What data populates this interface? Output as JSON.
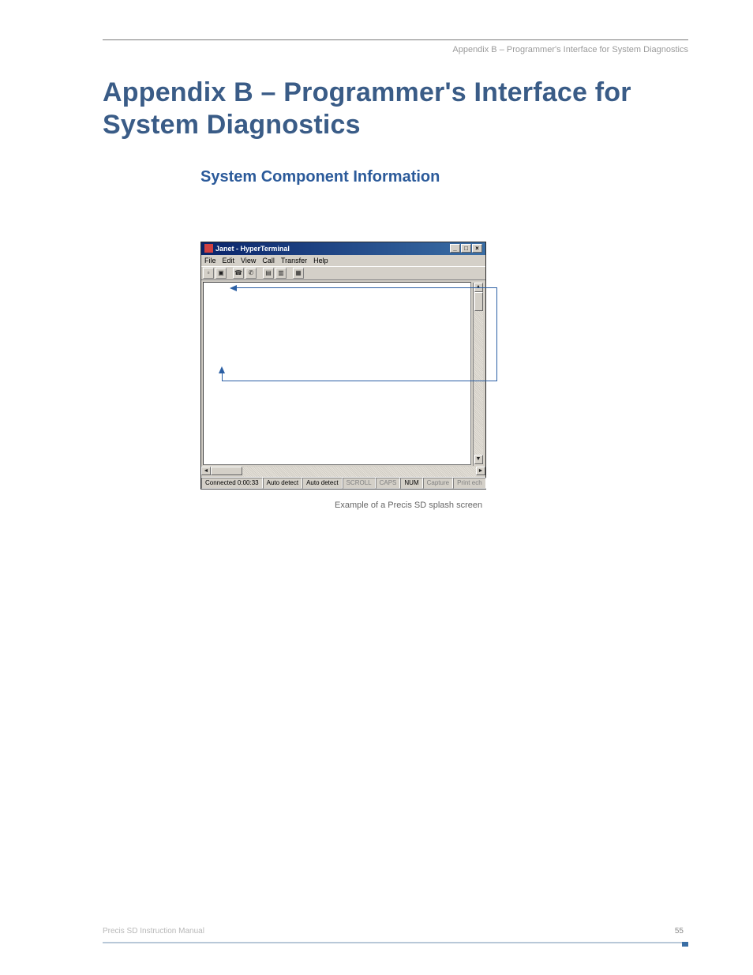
{
  "breadcrumb": "Appendix B – Programmer's Interface for System Diagnostics",
  "page_title": "Appendix B – Programmer's Interface for System Diagnostics",
  "section_heading": "System Component Information",
  "figure_caption": "Example of a Precis SD splash screen",
  "hyperterminal": {
    "title": "Janet - HyperTerminal",
    "menu": [
      "File",
      "Edit",
      "View",
      "Call",
      "Transfer",
      "Help"
    ],
    "win_buttons": {
      "minimize": "_",
      "maximize": "□",
      "close": "×"
    },
    "toolbar_icons": [
      "new-icon",
      "open-icon",
      "connect-icon",
      "disconnect-icon",
      "send-icon",
      "receive-icon",
      "properties-icon"
    ],
    "status": {
      "connected": "Connected 0:00:33",
      "detect1": "Auto detect",
      "detect2": "Auto detect",
      "scroll": "SCROLL",
      "caps": "CAPS",
      "num": "NUM",
      "capture": "Capture",
      "print": "Print ech"
    }
  },
  "footer": {
    "manual": "Precis SD Instruction Manual",
    "page": "55"
  }
}
